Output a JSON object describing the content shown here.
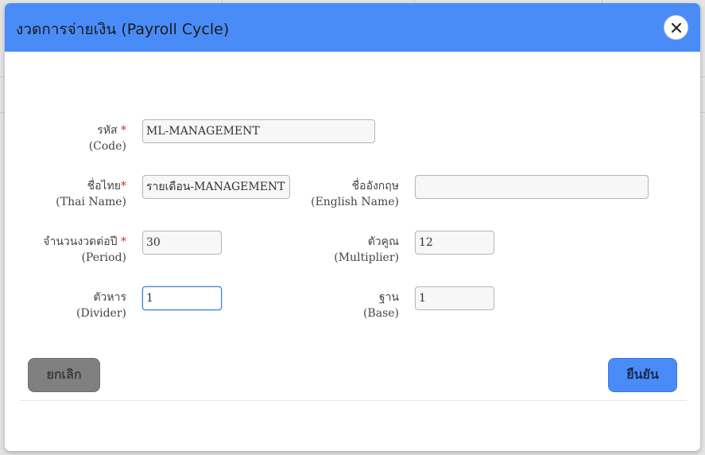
{
  "colors": {
    "header": "#4a8cf7",
    "required": "#e0262b",
    "cancel": "#808080",
    "confirm": "#4a8cf7"
  },
  "dialog": {
    "title": "งวดการจ่ายเงิน (Payroll Cycle)",
    "close_icon": "close-icon"
  },
  "fields": {
    "code": {
      "label_th": "รหัส",
      "label_en": "(Code)",
      "required": "*",
      "value": "ML-MANAGEMENT"
    },
    "thai_name": {
      "label_th": "ชื่อไทย",
      "label_en": "(Thai Name)",
      "required": "*",
      "value": "รายเดือน-MANAGEMENT"
    },
    "english_name": {
      "label_th": "ชื่ออังกฤษ",
      "label_en": "(English Name)",
      "value": ""
    },
    "period": {
      "label_th": "จำนวนงวดต่อปี",
      "label_en": "(Period)",
      "required": "*",
      "value": "30"
    },
    "multiplier": {
      "label_th": "ตัวคูณ",
      "label_en": "(Multiplier)",
      "value": "12"
    },
    "divider": {
      "label_th": "ตัวหาร",
      "label_en": "(Divider)",
      "value": "1"
    },
    "base": {
      "label_th": "ฐาน",
      "label_en": "(Base)",
      "value": "1"
    }
  },
  "buttons": {
    "cancel": "ยกเลิก",
    "confirm": "ยืนยัน"
  }
}
